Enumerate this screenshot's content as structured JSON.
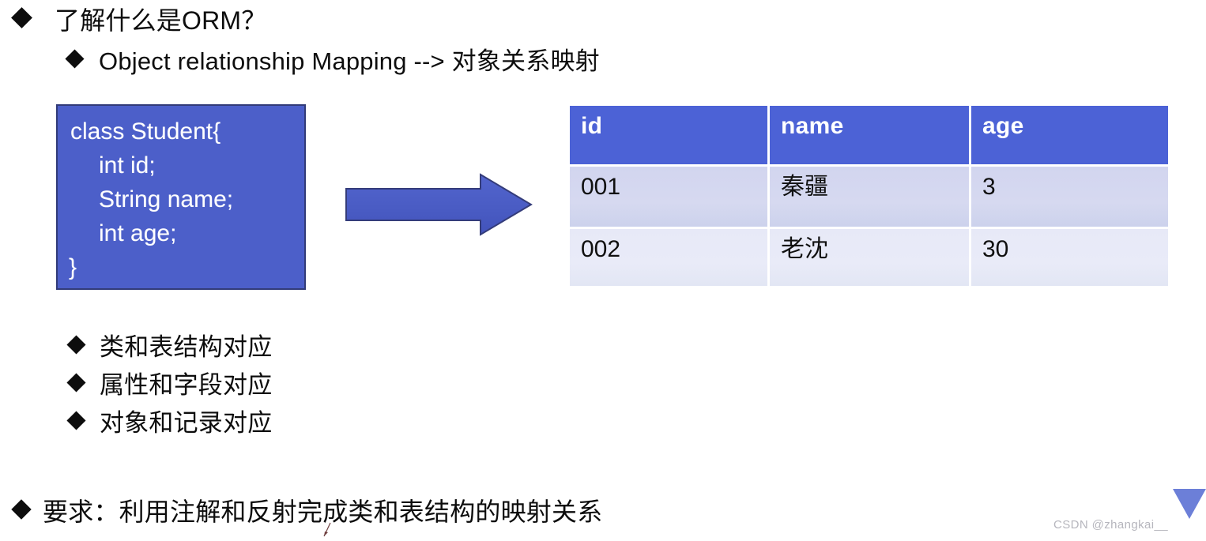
{
  "slide": {
    "heading_1": "了解什么是ORM？",
    "heading_2": "Object relationship Mapping --> 对象关系映射",
    "requirement": "要求：利用注解和反射完成类和表结构的映射关系"
  },
  "code_box": {
    "background_color": "#4c5fc9",
    "border_color": "#323b78",
    "text_color": "#ffffff",
    "lines": [
      "class Student{",
      "int id;",
      "String name;",
      "int age;",
      "}"
    ]
  },
  "arrow": {
    "name": "right-arrow",
    "fill_color": "#4c5fc4",
    "stroke_color": "#343c7a"
  },
  "table": {
    "header_background": "#4c62d6",
    "header_text_color": "#ffffff",
    "row1_background": "#d4d7ef",
    "row2_background": "#e8eaf7",
    "columns": [
      "id",
      "name",
      "age"
    ],
    "rows": [
      [
        "001",
        "秦疆",
        "3"
      ],
      [
        "002",
        "老沈",
        "30"
      ]
    ]
  },
  "mapping_list": [
    "类和表结构对应",
    "属性和字段对应",
    "对象和记录对应"
  ],
  "watermark": {
    "text": "CSDN @zhangkai__",
    "logo_color": "#6c7fd8"
  }
}
